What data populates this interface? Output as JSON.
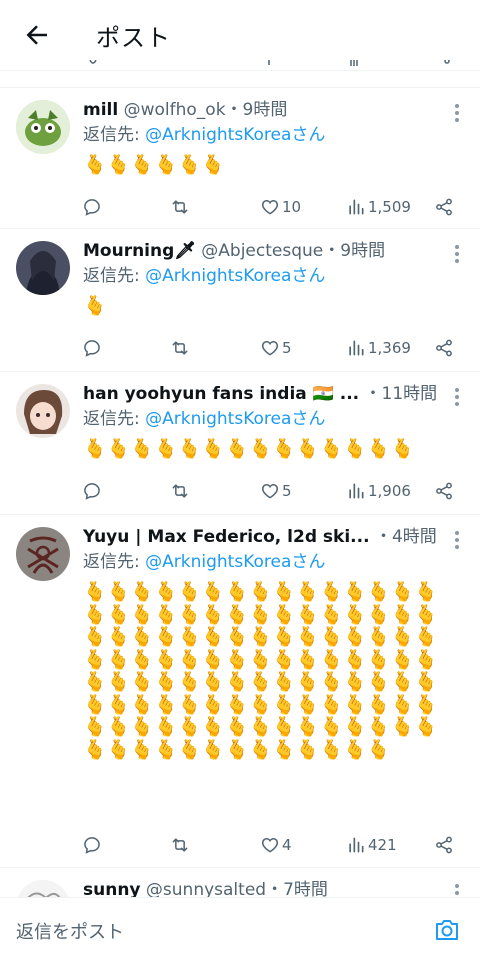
{
  "header": {
    "title": "ポスト"
  },
  "tweets": [
    {
      "name": "mill",
      "handle": "@wolfho_ok",
      "time": "・9時間",
      "reply_prefix": "返信先: ",
      "reply_to": "@ArknightsKorea",
      "reply_suffix": "さん",
      "body": "🫰🫰🫰🫰🫰🫰",
      "replies": "",
      "reposts": "",
      "likes": "10",
      "views": "1,509"
    },
    {
      "name": "Mourning🗡",
      "handle": "@Abjectesque",
      "time": "・9時間",
      "reply_prefix": "返信先: ",
      "reply_to": "@ArknightsKorea",
      "reply_suffix": "さん",
      "body": "🫰",
      "replies": "",
      "reposts": "",
      "likes": "5",
      "views": "1,369"
    },
    {
      "name": "han yoohyun fans india 🇮🇳 ...",
      "handle": "",
      "time": "・11時間",
      "reply_prefix": "返信先: ",
      "reply_to": "@ArknightsKorea",
      "reply_suffix": "さん",
      "body": "🫰🫰🫰🫰🫰🫰🫰🫰🫰🫰🫰🫰🫰🫰",
      "replies": "",
      "reposts": "",
      "likes": "5",
      "views": "1,906"
    },
    {
      "name": "Yuyu | Max Federico, l2d ski...",
      "handle": "",
      "time": "・4時間",
      "reply_prefix": "返信先: ",
      "reply_to": "@ArknightsKorea",
      "reply_suffix": "さん",
      "body": "🫰🫰🫰🫰🫰🫰🫰🫰🫰🫰🫰🫰🫰🫰🫰🫰🫰🫰🫰🫰🫰🫰🫰🫰🫰🫰🫰🫰🫰🫰🫰🫰🫰🫰🫰🫰🫰🫰🫰🫰🫰🫰🫰🫰🫰🫰🫰🫰🫰🫰🫰🫰🫰🫰🫰🫰🫰🫰🫰🫰🫰🫰🫰🫰🫰🫰🫰🫰🫰🫰🫰🫰🫰🫰🫰🫰🫰🫰🫰🫰🫰🫰🫰🫰🫰🫰🫰🫰🫰🫰🫰🫰🫰🫰🫰🫰🫰🫰🫰🫰🫰🫰🫰🫰🫰🫰🫰🫰🫰🫰🫰🫰🫰🫰🫰🫰🫰🫰",
      "replies": "",
      "reposts": "",
      "likes": "4",
      "views": "421"
    },
    {
      "name": "sunny",
      "handle": "@sunnysalted",
      "time": "・7時間"
    }
  ],
  "footer": {
    "reply_placeholder": "返信をポスト"
  },
  "colors": {
    "link": "#1d9bf0",
    "muted": "#536471",
    "divider": "#eff3f4"
  }
}
